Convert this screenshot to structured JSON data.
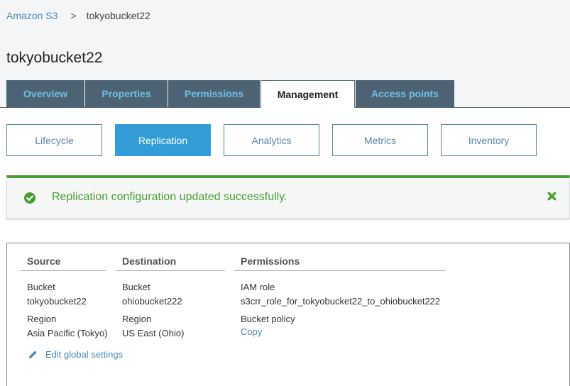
{
  "breadcrumb": {
    "root": "Amazon S3",
    "separator": ">",
    "current": "tokyobucket22"
  },
  "page_title": "tokyobucket22",
  "tabs": [
    {
      "label": "Overview",
      "active": false
    },
    {
      "label": "Properties",
      "active": false
    },
    {
      "label": "Permissions",
      "active": false
    },
    {
      "label": "Management",
      "active": true
    },
    {
      "label": "Access points",
      "active": false
    }
  ],
  "subtabs": [
    {
      "label": "Lifecycle",
      "active": false
    },
    {
      "label": "Replication",
      "active": true
    },
    {
      "label": "Analytics",
      "active": false
    },
    {
      "label": "Metrics",
      "active": false
    },
    {
      "label": "Inventory",
      "active": false
    }
  ],
  "flash": {
    "icon": "check-circle-icon",
    "message": "Replication configuration updated successfully.",
    "close_icon": "close-icon",
    "color": "#4b9e33"
  },
  "replication": {
    "source": {
      "header": "Source",
      "bucket_label": "Bucket",
      "bucket_value": "tokyobucket22",
      "region_label": "Region",
      "region_value": "Asia Pacific (Tokyo)"
    },
    "destination": {
      "header": "Destination",
      "bucket_label": "Bucket",
      "bucket_value": "ohiobucket222",
      "region_label": "Region",
      "region_value": "US East (Ohio)"
    },
    "permissions": {
      "header": "Permissions",
      "iam_role_label": "IAM role",
      "iam_role_value": "s3crr_role_for_tokyobucket22_to_ohiobucket222",
      "bucket_policy_label": "Bucket policy",
      "bucket_policy_link": "Copy"
    },
    "edit_link": "Edit global settings"
  },
  "colors": {
    "tab_bg": "#4d6374",
    "tab_text": "#6fc0e6",
    "accent": "#319cd6",
    "link": "#4a8ab8",
    "success": "#4b9e33"
  }
}
